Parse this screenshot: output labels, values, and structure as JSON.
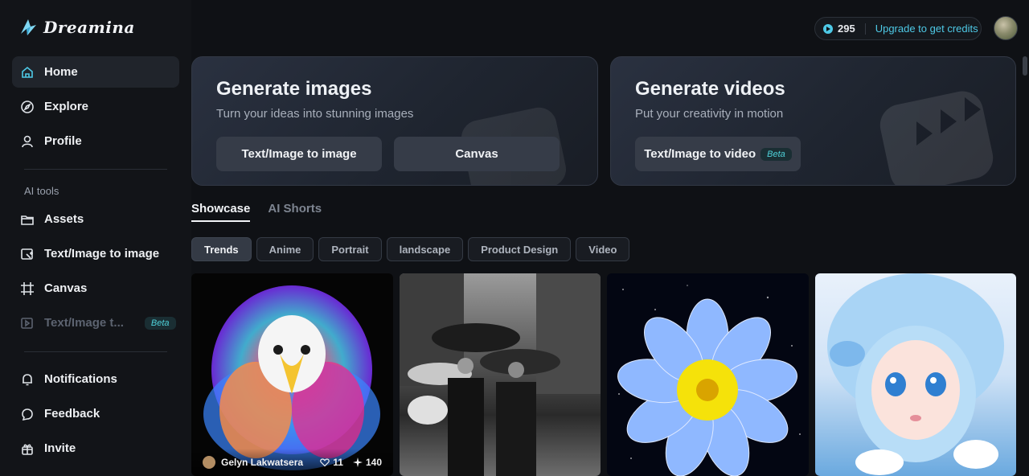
{
  "brand": {
    "name": "Dreamina"
  },
  "credits": {
    "count": "295",
    "upgrade_label": "Upgrade to get credits"
  },
  "sidebar": {
    "items": [
      {
        "label": "Home",
        "icon": "home-icon"
      },
      {
        "label": "Explore",
        "icon": "explore-icon"
      },
      {
        "label": "Profile",
        "icon": "profile-icon"
      }
    ],
    "section_label": "AI tools",
    "tools": [
      {
        "label": "Assets",
        "icon": "folder-icon"
      },
      {
        "label": "Text/Image to image",
        "icon": "image-edit-icon"
      },
      {
        "label": "Canvas",
        "icon": "canvas-icon"
      },
      {
        "label": "Text/Image t...",
        "icon": "video-edit-icon",
        "badge": "Beta"
      }
    ],
    "bottom": [
      {
        "label": "Notifications",
        "icon": "bell-icon"
      },
      {
        "label": "Feedback",
        "icon": "feedback-icon"
      },
      {
        "label": "Invite",
        "icon": "invite-icon"
      }
    ]
  },
  "cards": {
    "images": {
      "title": "Generate images",
      "subtitle": "Turn your ideas into stunning images",
      "btn1": "Text/Image to image",
      "btn2": "Canvas"
    },
    "videos": {
      "title": "Generate videos",
      "subtitle": "Put your creativity in motion",
      "btn1": "Text/Image to video",
      "badge": "Beta"
    }
  },
  "tabs": [
    "Showcase",
    "AI Shorts"
  ],
  "filters": [
    "Trends",
    "Anime",
    "Portrait",
    "landscape",
    "Product Design",
    "Video"
  ],
  "gallery": {
    "first": {
      "author": "Gelyn Lakwatsera",
      "likes": "11",
      "uses": "140"
    }
  },
  "colors": {
    "accent": "#4ec9e6",
    "background": "#0f1115"
  }
}
